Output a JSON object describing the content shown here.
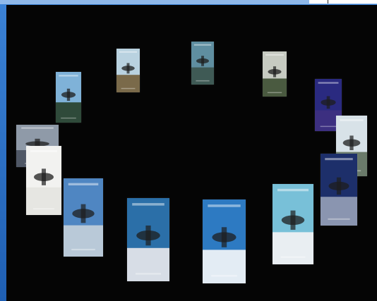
{
  "window": {
    "accent": "#3b82d6",
    "stage_color": "#050505"
  },
  "carousel": {
    "label": "",
    "cards": [
      {
        "id": "c1",
        "icon": "helicopter-poster-icon",
        "sky": "#b9d2e0",
        "ground": "#7a6a4a"
      },
      {
        "id": "c2",
        "icon": "jet-poster-icon",
        "sky": "#5f8ea0",
        "ground": "#3f5a55"
      },
      {
        "id": "c3",
        "icon": "helicopter-poster-icon",
        "sky": "#c7cbc2",
        "ground": "#4a5a40"
      },
      {
        "id": "c4",
        "icon": "soldiers-poster-icon",
        "sky": "#7fb2d8",
        "ground": "#2f4a3a"
      },
      {
        "id": "c5",
        "icon": "night-poster-icon",
        "sky": "#2a2a80",
        "ground": "#3c2f80"
      },
      {
        "id": "c6",
        "icon": "helicopter-poster-icon",
        "sky": "#d8e2e8",
        "ground": "#6a7a6a"
      },
      {
        "id": "c7",
        "icon": "aircraft-poster-icon",
        "sky": "#8f9aa8",
        "ground": "#505866"
      },
      {
        "id": "c8",
        "icon": "emblem-poster-icon",
        "sky": "#f2f2f0",
        "ground": "#e6e6e2"
      },
      {
        "id": "c9",
        "icon": "pilot-poster-icon",
        "sky": "#1d2f6a",
        "ground": "#8a95b0"
      },
      {
        "id": "c10",
        "icon": "city-poster-icon",
        "sky": "#4f86c2",
        "ground": "#b9c9d8"
      },
      {
        "id": "c11",
        "icon": "fighter-jet-poster-icon",
        "sky": "#2b6fa8",
        "ground": "#d7dde6"
      },
      {
        "id": "c12",
        "icon": "radome-poster-icon",
        "sky": "#2d7ac2",
        "ground": "#e3ecf4"
      },
      {
        "id": "c13",
        "icon": "tower-poster-icon",
        "sky": "#78c0d8",
        "ground": "#e9eef2"
      }
    ]
  }
}
